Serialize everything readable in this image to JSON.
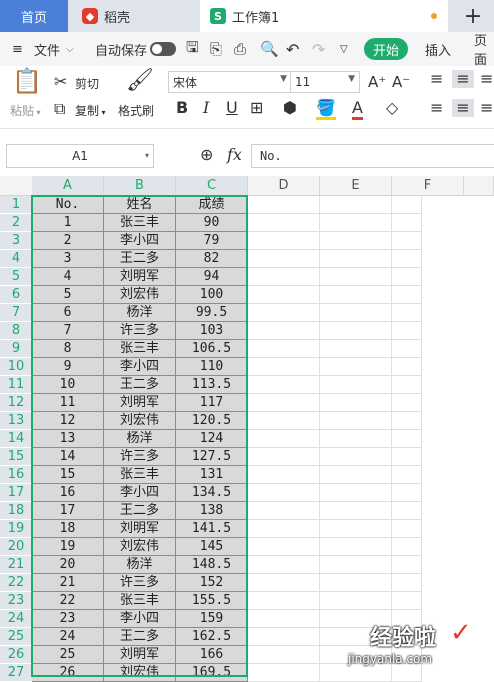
{
  "tabs": {
    "home": "首页",
    "daoke": "稻壳",
    "workbook": "工作簿1",
    "new_tab": "+"
  },
  "menu": {
    "file": "文件",
    "autosave": "自动保存",
    "start": "开始",
    "insert": "插入",
    "page": "页面"
  },
  "ribbon": {
    "paste": "粘贴",
    "cut": "剪切",
    "copy": "复制",
    "format_painter": "格式刷",
    "font_name": "宋体",
    "font_size": "11",
    "bold": "B",
    "italic": "I",
    "underline": "U"
  },
  "formula_bar": {
    "name_box": "A1",
    "fx": "fx",
    "value": "No."
  },
  "columns": [
    "A",
    "B",
    "C",
    "D",
    "E",
    "F"
  ],
  "table": {
    "headers": [
      "No.",
      "姓名",
      "成绩"
    ],
    "rows": [
      [
        "1",
        "张三丰",
        "90"
      ],
      [
        "2",
        "李小四",
        "79"
      ],
      [
        "3",
        "王二多",
        "82"
      ],
      [
        "4",
        "刘明军",
        "94"
      ],
      [
        "5",
        "刘宏伟",
        "100"
      ],
      [
        "6",
        "杨洋",
        "99.5"
      ],
      [
        "7",
        "许三多",
        "103"
      ],
      [
        "8",
        "张三丰",
        "106.5"
      ],
      [
        "9",
        "李小四",
        "110"
      ],
      [
        "10",
        "王二多",
        "113.5"
      ],
      [
        "11",
        "刘明军",
        "117"
      ],
      [
        "12",
        "刘宏伟",
        "120.5"
      ],
      [
        "13",
        "杨洋",
        "124"
      ],
      [
        "14",
        "许三多",
        "127.5"
      ],
      [
        "15",
        "张三丰",
        "131"
      ],
      [
        "16",
        "李小四",
        "134.5"
      ],
      [
        "17",
        "王二多",
        "138"
      ],
      [
        "18",
        "刘明军",
        "141.5"
      ],
      [
        "19",
        "刘宏伟",
        "145"
      ],
      [
        "20",
        "杨洋",
        "148.5"
      ],
      [
        "21",
        "许三多",
        "152"
      ],
      [
        "22",
        "张三丰",
        "155.5"
      ],
      [
        "23",
        "李小四",
        "159"
      ],
      [
        "24",
        "王二多",
        "162.5"
      ],
      [
        "25",
        "刘明军",
        "166"
      ],
      [
        "26",
        "刘宏伟",
        "169.5"
      ]
    ]
  },
  "row_numbers": [
    "1",
    "2",
    "3",
    "4",
    "5",
    "6",
    "7",
    "8",
    "9",
    "10",
    "11",
    "12",
    "13",
    "14",
    "15",
    "16",
    "17",
    "18",
    "19",
    "20",
    "21",
    "22",
    "23",
    "24",
    "25",
    "26",
    "27"
  ],
  "watermark": {
    "text": "经验啦",
    "url": "jingyanla.com",
    "check": "✓"
  },
  "colors": {
    "accent": "#1fab6d",
    "home_tab": "#4b7fd8",
    "daoke_logo": "#e23b2e"
  }
}
